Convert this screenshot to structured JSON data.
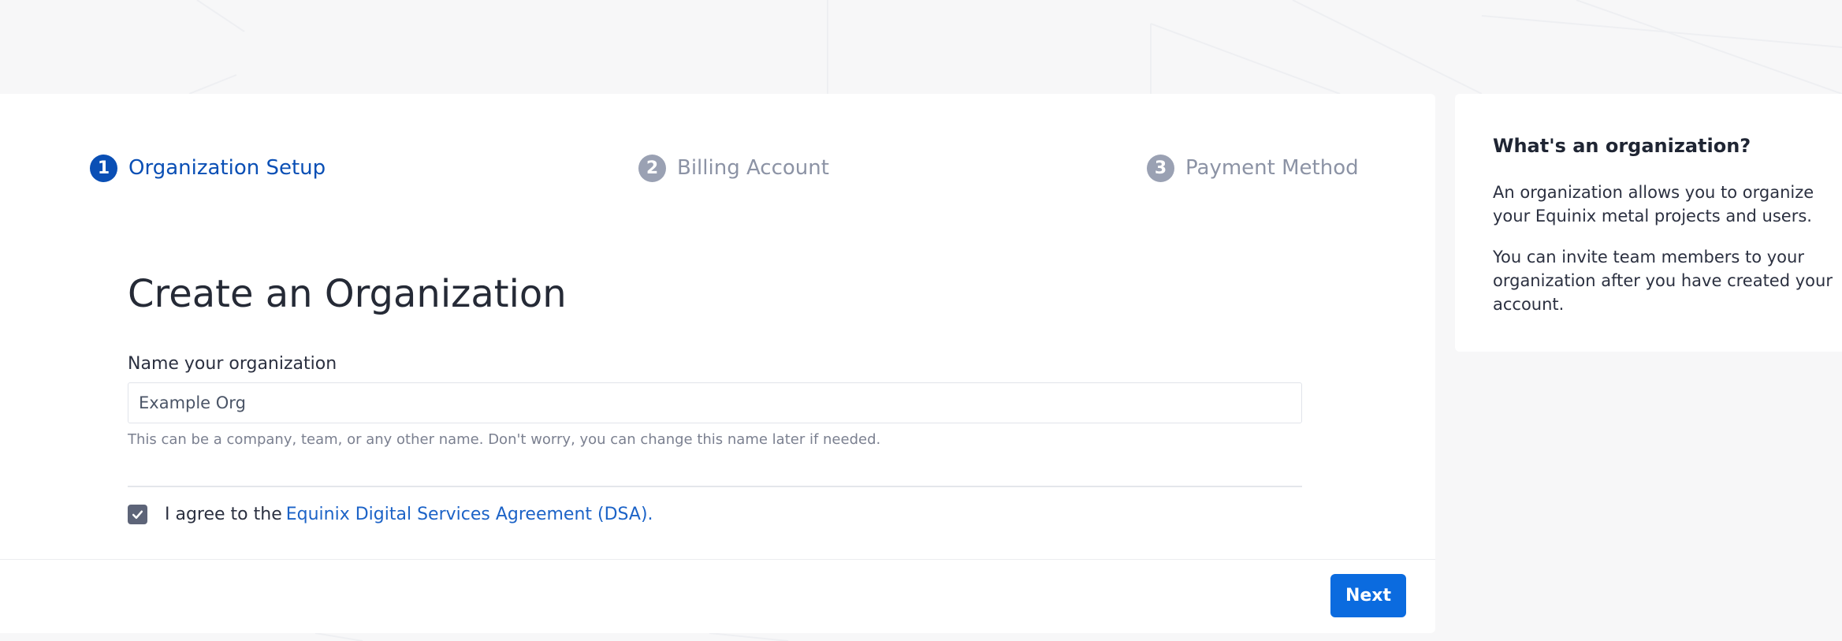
{
  "stepper": {
    "steps": [
      {
        "number": "1",
        "label": "Organization Setup",
        "state": "active"
      },
      {
        "number": "2",
        "label": "Billing Account",
        "state": "inactive"
      },
      {
        "number": "3",
        "label": "Payment Method",
        "state": "inactive"
      }
    ]
  },
  "form": {
    "title": "Create an Organization",
    "name_label": "Name your organization",
    "name_value": "Example Org",
    "name_hint": "This can be a company, team, or any other name. Don't worry, you can change this name later if needed.",
    "agree_checked": true,
    "agree_text": "I agree to the",
    "agree_link": "Equinix Digital Services Agreement (DSA)."
  },
  "footer": {
    "next_label": "Next"
  },
  "sidebar": {
    "title": "What's an organization?",
    "paragraphs": [
      "An organization allows you to organize your Equinix metal projects and users.",
      "You can invite team members to your organization after you have created your account."
    ]
  },
  "colors": {
    "primary": "#0b6bdf",
    "active_step": "#0a4fb5",
    "inactive_step": "#9aa1b3",
    "link": "#1c63c7",
    "checkbox": "#5d6478",
    "background": "#f7f7f8"
  },
  "icons": {
    "checkbox": "checkmark-icon"
  }
}
